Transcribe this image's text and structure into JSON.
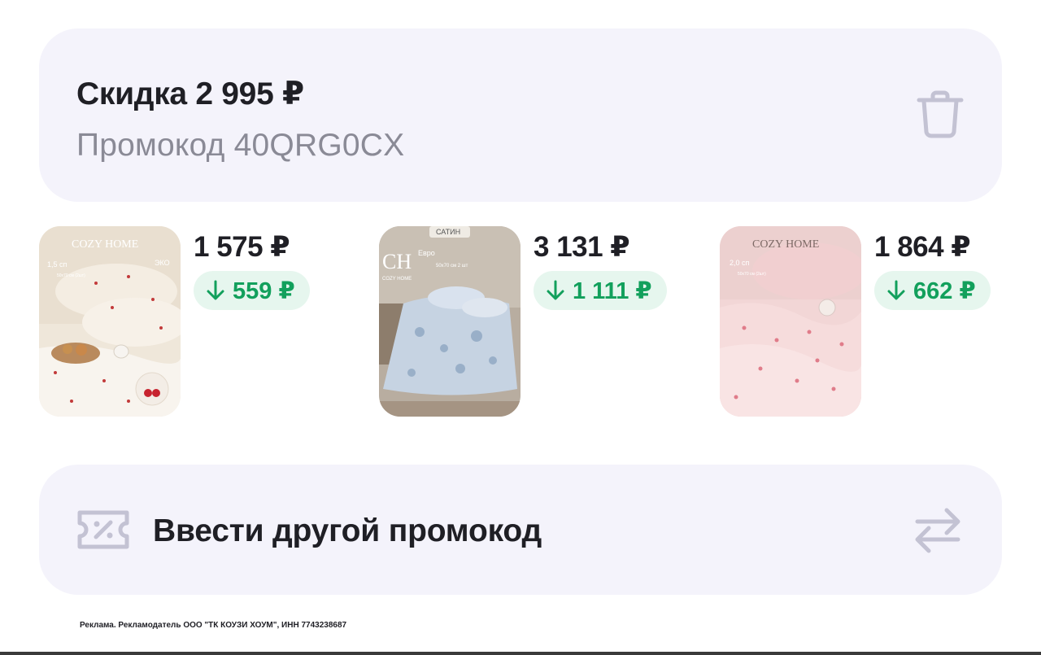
{
  "promo": {
    "title": "Скидка 2 995 ₽",
    "code": "Промокод 40QRG0CX",
    "delete_icon": "trash-icon"
  },
  "products": [
    {
      "price": "1 575 ₽",
      "discount": "559 ₽",
      "image": {
        "brand": "COZY HOME",
        "size": "1,5 сп",
        "badge": "ЭКО",
        "pillow_note": "50х70 см (2шт)"
      }
    },
    {
      "price": "3 131 ₽",
      "discount": "1 111 ₽",
      "image": {
        "brand": "COZY HOME",
        "logo": "CH",
        "tag": "САТИН",
        "size": "Евро",
        "pillow_note": "50х70 см 2 шт"
      }
    },
    {
      "price": "1 864 ₽",
      "discount": "662 ₽",
      "image": {
        "brand": "COZY HOME",
        "size": "2,0 сп",
        "pillow_note": "50х70 см (2шт)"
      }
    }
  ],
  "other_promo": {
    "label": "Ввести другой промокод",
    "left_icon": "coupon-icon",
    "right_icon": "swap-icon"
  },
  "ad_note": "Реклама. Рекламодатель ООО \"ТК КОУЗИ ХОУМ\", ИНН 7743238687",
  "colors": {
    "card_bg": "#f4f3fb",
    "discount_bg": "#e6f6ee",
    "discount_text": "#12a05c",
    "muted": "#8a8a96",
    "icon": "#c3c2d3"
  }
}
